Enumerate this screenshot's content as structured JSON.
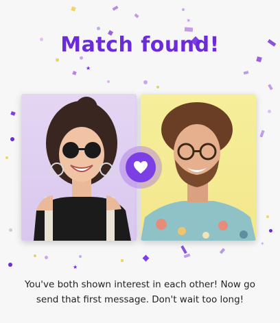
{
  "header": {
    "title": "Match found!"
  },
  "match": {
    "left_photo": {
      "description_icon": "woman-with-sunglasses-portrait"
    },
    "right_photo": {
      "description_icon": "man-with-glasses-portrait"
    },
    "badge_icon": "heart-icon"
  },
  "message": {
    "text": "You've both shown interest in each other! Now go send that first message. Don't wait too long!"
  },
  "colors": {
    "accent": "#6c2bd9",
    "badge": "#7b3fe4",
    "background": "#f7f7f7",
    "left_bg": "#dccbef",
    "right_bg": "#f4e98f"
  }
}
